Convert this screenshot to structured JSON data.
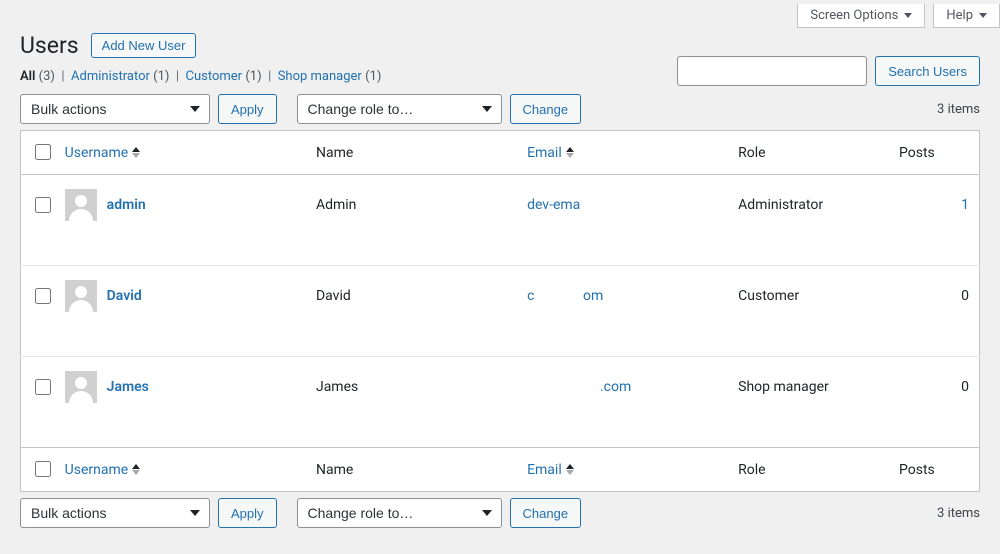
{
  "top_tabs": {
    "screen_options": "Screen Options",
    "help": "Help"
  },
  "page_title": "Users",
  "add_new_label": "Add New User",
  "filters": {
    "all_label": "All",
    "all_count": "(3)",
    "items": [
      {
        "label": "Administrator",
        "count": "(1)"
      },
      {
        "label": "Customer",
        "count": "(1)"
      },
      {
        "label": "Shop manager",
        "count": "(1)"
      }
    ]
  },
  "search_button": "Search Users",
  "bulk": {
    "placeholder": "Bulk actions",
    "apply": "Apply"
  },
  "role_change": {
    "placeholder": "Change role to…",
    "change": "Change"
  },
  "items_count": "3 items",
  "columns": {
    "username": "Username",
    "name": "Name",
    "email": "Email",
    "role": "Role",
    "posts": "Posts"
  },
  "rows": [
    {
      "username": "admin",
      "name": "Admin",
      "email": "dev-ema",
      "role": "Administrator",
      "posts": "1",
      "posts_link": true
    },
    {
      "username": "David",
      "name": "David",
      "email": "c              om",
      "role": "Customer",
      "posts": "0",
      "posts_link": false
    },
    {
      "username": "James",
      "name": "James",
      "email": "                     .com",
      "role": "Shop manager",
      "posts": "0",
      "posts_link": false
    }
  ]
}
